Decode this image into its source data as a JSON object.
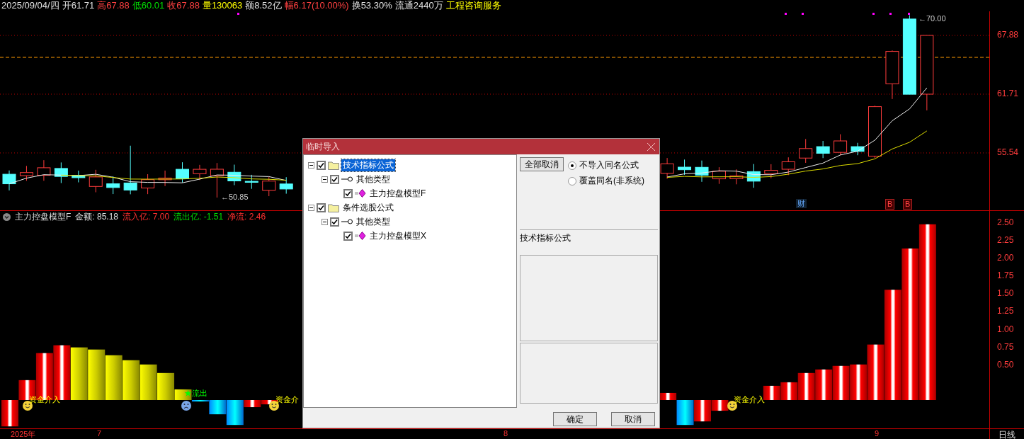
{
  "quote": {
    "items": [
      {
        "text": "2025/09/04/四",
        "color": "#e0e0e0"
      },
      {
        "text": "开61.71",
        "color": "#e0e0e0"
      },
      {
        "text": "高67.88",
        "color": "#ff4040"
      },
      {
        "text": "低60.01",
        "color": "#00e000"
      },
      {
        "text": "收67.88",
        "color": "#ff4040"
      },
      {
        "text": "量130063",
        "color": "#ffff00"
      },
      {
        "text": "额8.52亿",
        "color": "#e0e0e0"
      },
      {
        "text": "幅6.17(10.00%)",
        "color": "#ff4040"
      },
      {
        "text": "换53.30%",
        "color": "#e0e0e0"
      },
      {
        "text": "流通2440万",
        "color": "#e0e0e0"
      },
      {
        "text": "工程咨询服务",
        "color": "#ffff00"
      }
    ]
  },
  "price_panel": {
    "axis_labels": [
      "67.88",
      "61.71",
      "55.54"
    ],
    "high_label": "←70.00",
    "low_label": "←50.85",
    "badges": [
      {
        "text": "财",
        "kind": "finance"
      },
      {
        "text": "B",
        "kind": "buy"
      },
      {
        "text": "B",
        "kind": "buy"
      }
    ]
  },
  "indicator_panel": {
    "name": "主力控盘模型F",
    "values": [
      {
        "text": "金额: 85.18",
        "color": "#e0e0e0"
      },
      {
        "text": "流入亿: 7.00",
        "color": "#ff3030"
      },
      {
        "text": "流出亿: -1.51",
        "color": "#00e000"
      },
      {
        "text": "净流: 2.46",
        "color": "#ff3030"
      }
    ],
    "axis_labels": [
      "2.50",
      "2.25",
      "2.00",
      "1.75",
      "1.50",
      "1.25",
      "1.00",
      "0.75",
      "0.50"
    ],
    "signals": [
      {
        "kind": "in",
        "text": "资金介入"
      },
      {
        "kind": "out",
        "text": "★流出"
      },
      {
        "kind": "in",
        "text": "资金介"
      },
      {
        "kind": "in",
        "text": "资金介入"
      }
    ]
  },
  "time_axis": {
    "labels": [
      "2025年",
      "7",
      "8",
      "9"
    ],
    "period": "日线"
  },
  "dialog": {
    "title": "临时导入",
    "tree": [
      {
        "kind": "folder",
        "label": "技术指标公式",
        "checked": true,
        "expanded": true,
        "selected": true,
        "children": [
          {
            "kind": "type",
            "label": "其他类型",
            "checked": true,
            "expanded": true,
            "selected": false,
            "children": [
              {
                "kind": "formula",
                "label": "主力控盘模型F",
                "checked": true,
                "selected": false
              }
            ]
          }
        ]
      },
      {
        "kind": "folder",
        "label": "条件选股公式",
        "checked": true,
        "expanded": true,
        "selected": false,
        "children": [
          {
            "kind": "type",
            "label": "其他类型",
            "checked": true,
            "expanded": true,
            "selected": false,
            "children": [
              {
                "kind": "formula",
                "label": "主力控盘模型X",
                "checked": true,
                "selected": false
              }
            ]
          }
        ]
      }
    ],
    "clear_button": "全部取消",
    "options": [
      {
        "label": "不导入同名公式",
        "selected": true
      },
      {
        "label": "覆盖同名(非系统)",
        "selected": false
      }
    ],
    "group_label": "技术指标公式",
    "buttons": [
      "确定",
      "取消"
    ]
  }
}
